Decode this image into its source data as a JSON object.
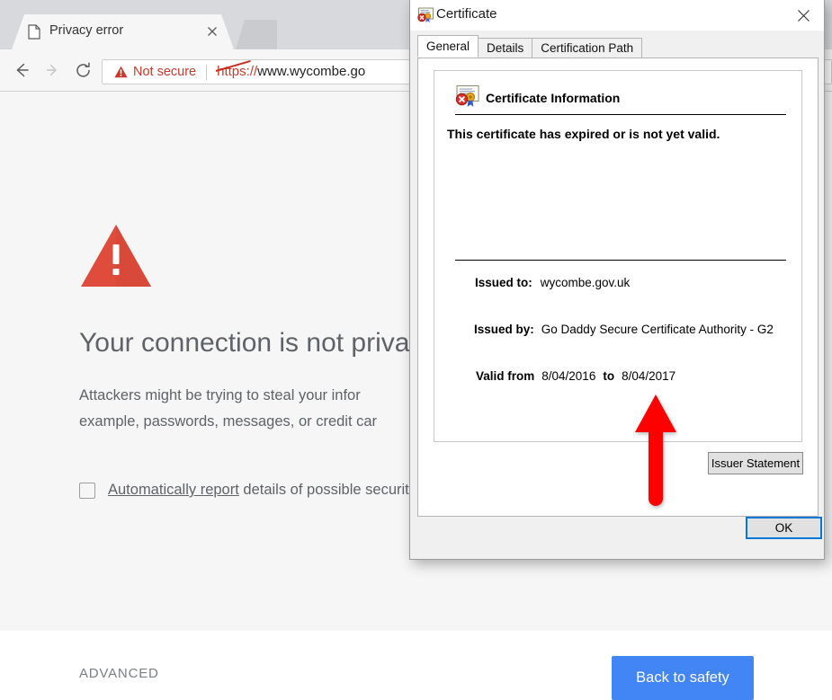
{
  "browser": {
    "tab": {
      "title": "Privacy error",
      "favicon_icon": "page-icon",
      "close_icon": "close-icon"
    },
    "nav": {
      "back_icon": "arrow-left-icon",
      "forward_icon": "arrow-right-icon",
      "reload_icon": "reload-icon"
    },
    "omnibox": {
      "security_icon": "warning-triangle-icon",
      "security_label": "Not secure",
      "url_scheme": "https",
      "url_separator": "://",
      "url_host": "www.wycombe.go",
      "scheme_struck_through": true,
      "danger_color": "#c5392e"
    }
  },
  "interstitial": {
    "warning_icon": "warning-triangle-icon",
    "warning_color": "#e04c3c",
    "heading": "Your connection is not priva",
    "body_line_1": "Attackers might be trying to steal your infor",
    "body_line_2": "example, passwords, messages, or credit car",
    "report_link_text": "Automatically report",
    "report_rest_text": " details of possible securit",
    "report_checked": false,
    "advanced_label": "ADVANCED",
    "back_to_safety_label": "Back to safety",
    "back_to_safety_color": "#4285f4"
  },
  "certificate_dialog": {
    "title": "Certificate",
    "title_icon": "certificate-icon",
    "close_icon": "close-icon",
    "tabs": [
      {
        "label": "General",
        "active": true
      },
      {
        "label": "Details",
        "active": false
      },
      {
        "label": "Certification Path",
        "active": false
      }
    ],
    "info_icon": "certificate-error-icon",
    "info_title": "Certificate Information",
    "status_text": "This certificate has expired or is not yet valid.",
    "fields": {
      "issued_to_label": "Issued to:",
      "issued_to_value": "wycombe.gov.uk",
      "issued_by_label": "Issued by:",
      "issued_by_value": "Go Daddy Secure Certificate Authority - G2",
      "valid_from_label": "Valid from",
      "valid_from_value": "8/04/2016",
      "valid_to_label": "to",
      "valid_to_value": "8/04/2017"
    },
    "issuer_statement_label": "Issuer Statement",
    "ok_label": "OK",
    "focus_color": "#0078d7"
  },
  "annotation": {
    "arrow_icon": "up-arrow-annotation",
    "arrow_color": "#ff0000",
    "points_at": "8/04/2017"
  }
}
